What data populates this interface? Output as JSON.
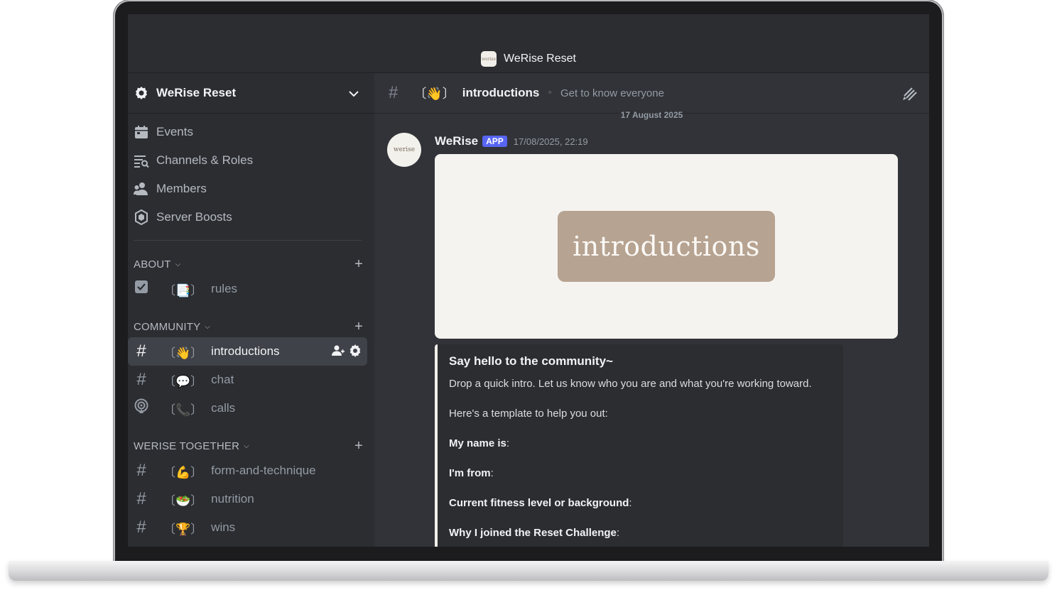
{
  "window": {
    "title": "WeRise Reset",
    "logo_text": "werise"
  },
  "server": {
    "name": "WeRise Reset"
  },
  "nav": [
    {
      "label": "Events",
      "icon": "calendar-icon"
    },
    {
      "label": "Channels & Roles",
      "icon": "channels-roles-icon"
    },
    {
      "label": "Members",
      "icon": "members-icon"
    },
    {
      "label": "Server Boosts",
      "icon": "boost-icon"
    }
  ],
  "categories": {
    "about": {
      "label": "ABOUT",
      "channels": [
        {
          "emoji": "〔📑〕",
          "name": "rules"
        }
      ]
    },
    "community": {
      "label": "COMMUNITY",
      "channels": [
        {
          "emoji": "〔👋〕",
          "name": "introductions"
        },
        {
          "emoji": "〔💬〕",
          "name": "chat"
        },
        {
          "emoji": "〔📞〕",
          "name": "calls"
        }
      ]
    },
    "together": {
      "label": "WERISE TOGETHER",
      "channels": [
        {
          "emoji": "〔💪〕",
          "name": "form-and-technique"
        },
        {
          "emoji": "〔🥗〕",
          "name": "nutrition"
        },
        {
          "emoji": "〔🏆〕",
          "name": "wins"
        }
      ]
    }
  },
  "channel_header": {
    "emoji": "〔👋〕",
    "name": "introductions",
    "topic": "Get to know everyone"
  },
  "date_separator": "17 August 2025",
  "message": {
    "author": "WeRise",
    "badge": "APP",
    "timestamp": "17/08/2025, 22:19",
    "avatar_text": "werise",
    "banner_text": "introductions",
    "embed": {
      "title": "Say hello to the community~",
      "line1": "Drop a quick intro. Let us know who you are and what you're working toward.",
      "line2": "Here's a template to help you out:",
      "field1": "My name is",
      "field2": "I'm from",
      "field3": "Current fitness level or background",
      "field4": "Why I joined the Reset Challenge"
    }
  }
}
